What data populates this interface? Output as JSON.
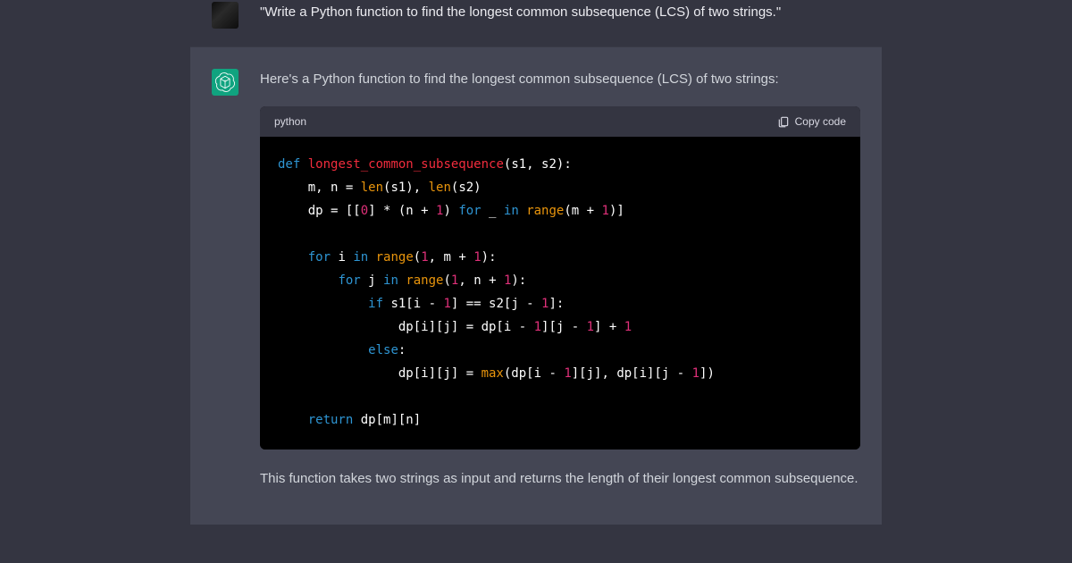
{
  "user_message": {
    "text": "\"Write a Python function to find the longest common subsequence (LCS) of two strings.\""
  },
  "assistant_message": {
    "intro": "Here's a Python function to find the longest common subsequence (LCS) of two strings:",
    "outro": "This function takes two strings as input and returns the length of their longest common subsequence."
  },
  "code_block": {
    "language": "python",
    "copy_label": "Copy code",
    "tokens": {
      "def": "def",
      "for": "for",
      "in": "in",
      "if": "if",
      "else": "else",
      "return": "return",
      "len": "len",
      "range": "range",
      "max": "max",
      "fn_name": "longest_common_subsequence",
      "n0": "0",
      "n1": "1"
    }
  }
}
